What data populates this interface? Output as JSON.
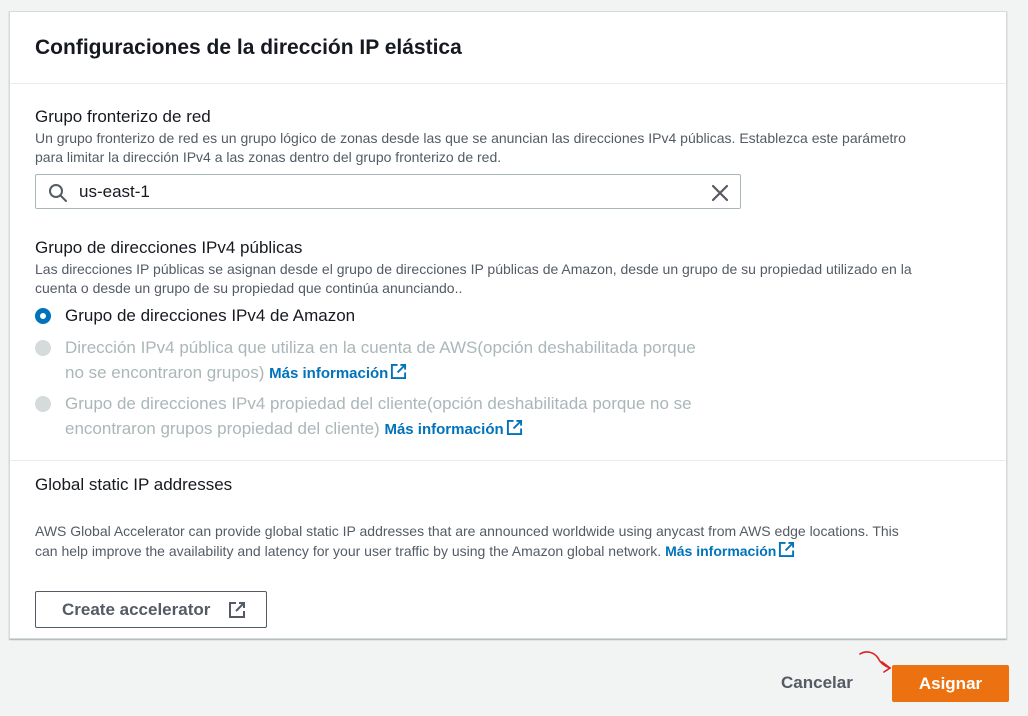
{
  "panel": {
    "title": "Configuraciones de la dirección IP elástica"
  },
  "network_border_group": {
    "label": "Grupo fronterizo de red",
    "description_line1": "Un grupo fronterizo de red es un grupo lógico de zonas desde las que se anuncian las direcciones IPv4 públicas. Establezca este parámetro",
    "description_line2": "para limitar la dirección IPv4 a las zonas dentro del grupo fronterizo de red.",
    "value": "us-east-1",
    "search_icon": "search-icon",
    "clear_icon": "close-icon"
  },
  "ipv4_pool": {
    "label": "Grupo de direcciones IPv4 públicas",
    "description_line1": "Las direcciones IP públicas se asignan desde el grupo de direcciones IP públicas de Amazon, desde un grupo de su propiedad utilizado en la",
    "description_line2": "cuenta o desde un grupo de su propiedad que continúa anunciando..",
    "options": [
      {
        "line1": "Grupo de direcciones IPv4 de Amazon",
        "selected": true,
        "disabled": false
      },
      {
        "line1": "Dirección IPv4 pública que utiliza en la cuenta de AWS(opción deshabilitada porque",
        "line2": "no se encontraron grupos)",
        "link": "Más información",
        "selected": false,
        "disabled": true
      },
      {
        "line1": "Grupo de direcciones IPv4 propiedad del cliente(opción deshabilitada porque no se",
        "line2": "encontraron grupos propiedad del cliente)",
        "link": "Más información",
        "selected": false,
        "disabled": true
      }
    ]
  },
  "global_static": {
    "label": "Global static IP addresses",
    "description_line1": "AWS Global Accelerator can provide global static IP addresses that are announced worldwide using anycast from AWS edge locations. This",
    "description_line2": "can help improve the availability and latency for your user traffic by using the Amazon global network.",
    "link": "Más información",
    "button_label": "Create accelerator",
    "button_icon": "external-link-icon"
  },
  "footer": {
    "cancel_label": "Cancelar",
    "submit_label": "Asignar"
  },
  "colors": {
    "primary": "#ec7211",
    "link": "#0073bb",
    "radio_selected": "#0073bb",
    "disabled_text": "#aab7b8"
  }
}
